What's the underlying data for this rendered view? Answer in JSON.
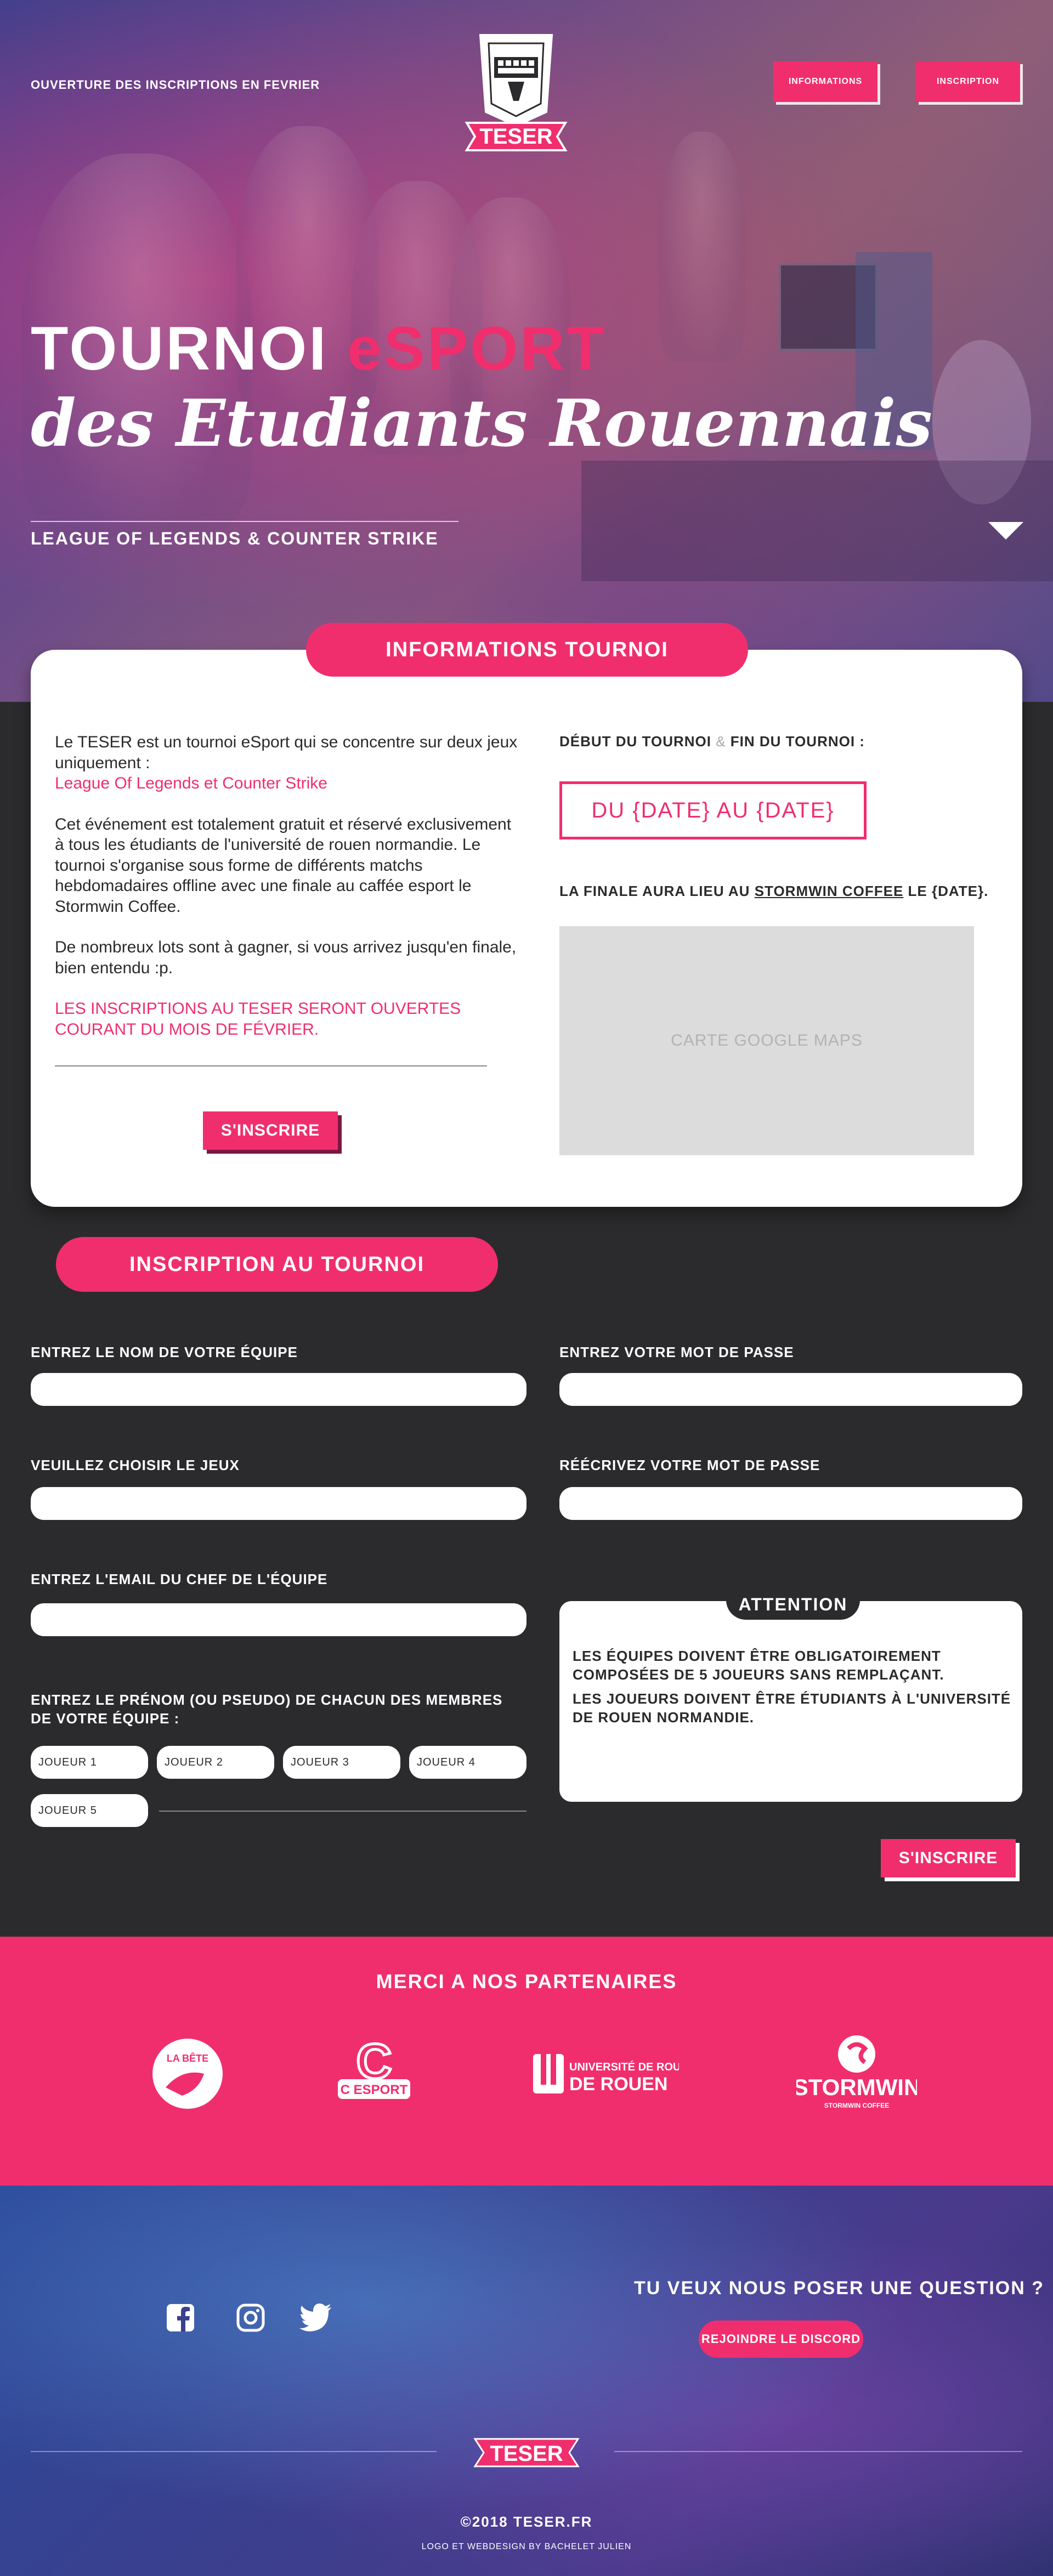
{
  "colors": {
    "accent": "#f02e6e",
    "dark": "#2b2b2d",
    "white": "#ffffff"
  },
  "hero": {
    "top_text": "OUVERTURE DES INSCRIPTIONS EN FEVRIER",
    "logo_text": "TESER",
    "nav": {
      "informations": "INFORMATIONS",
      "inscription": "INSCRIPTION"
    },
    "title_part1": "TOURNOI ",
    "title_part2": "eSPORT",
    "title_line2": "des Etudiants Rouennais",
    "subtitle": "LEAGUE OF LEGENDS & COUNTER STRIKE",
    "scroll_icon": "chevron-down-icon"
  },
  "info": {
    "section_title": "INFORMATIONS TOURNOI",
    "p1": "Le TESER est un tournoi eSport qui se concentre sur deux jeux uniquement :",
    "p1_games": "League Of Legends et Counter Strike",
    "p2": "Cet événement est totalement gratuit et réservé exclusivement à tous les étudiants de l'université de rouen normandie. Le tournoi s'organise sous forme de différents matchs hebdomadaires offline avec une finale au caffée esport le Stormwin Coffee.",
    "p3": "De nombreux lots sont à gagner, si vous arrivez jusqu'en finale, bien entendu :p.",
    "p4": "Les inscriptions au TESER seront ouvertes courant du mois de février.",
    "button": "S'INSCRIRE",
    "dates_label_start": "DÉBUT DU TOURNOI",
    "dates_label_amp": "&",
    "dates_label_end": "FIN DU TOURNOI :",
    "dates_value": "DU {DATE} AU {DATE}",
    "finale_prefix": "LA FINALE AURA LIEU AU ",
    "finale_place": "STORMWIN COFFEE",
    "finale_suffix": " LE {DATE}.",
    "map_placeholder": "CARTE GOOGLE MAPS"
  },
  "form": {
    "section_title": "INSCRIPTION AU TOURNOI",
    "team_name_label": "ENTREZ LE NOM DE VOTRE ÉQUIPE",
    "password_label": "ENTREZ VOTRE MOT DE PASSE",
    "game_label": "VEUILLEZ CHOISIR LE JEUX",
    "password_confirm_label": "RÉÉCRIVEZ VOTRE MOT DE PASSE",
    "email_label": "ENTREZ L'EMAIL DU CHEF DE L'ÉQUIPE",
    "members_label": "ENTREZ LE PRÉNOM (OU PSEUDO) DE CHACUN DES MEMBRES DE VOTRE ÉQUIPE :",
    "players": [
      "JOUEUR 1",
      "JOUEUR 2",
      "JOUEUR 3",
      "JOUEUR 4",
      "JOUEUR 5"
    ],
    "attention_title": "ATTENTION",
    "attention_1": "LES ÉQUIPES DOIVENT ÊTRE OBLIGATOIREMENT COMPOSÉES DE 5 JOUEURS SANS REMPLAÇANT.",
    "attention_2": "LES JOUEURS DOIVENT ÊTRE ÉTUDIANTS À L'UNIVERSITÉ DE ROUEN NORMANDIE.",
    "submit": "S'INSCRIRE"
  },
  "partners": {
    "title": "MERCI A NOS PARTENAIRES",
    "items": [
      {
        "name": "LA BÊTE",
        "icon": "la-bete-logo"
      },
      {
        "name": "C ESPORT",
        "icon": "c-esport-logo"
      },
      {
        "name": "UNIVERSITÉ DE ROUEN NORMANDIE",
        "icon": "universite-rouen-logo"
      },
      {
        "name": "STORMWIN COFFEE",
        "icon": "stormwin-logo"
      }
    ]
  },
  "footer": {
    "social": [
      "facebook-icon",
      "instagram-icon",
      "twitter-icon"
    ],
    "question": "TU VEUX NOUS POSER UNE QUESTION ?",
    "discord_button": "REJOINDRE LE DISCORD",
    "logo_text": "TESER",
    "copyright": "©2018 TESER.FR",
    "credit": "LOGO ET WEBDESIGN BY BACHELET JULIEN"
  }
}
